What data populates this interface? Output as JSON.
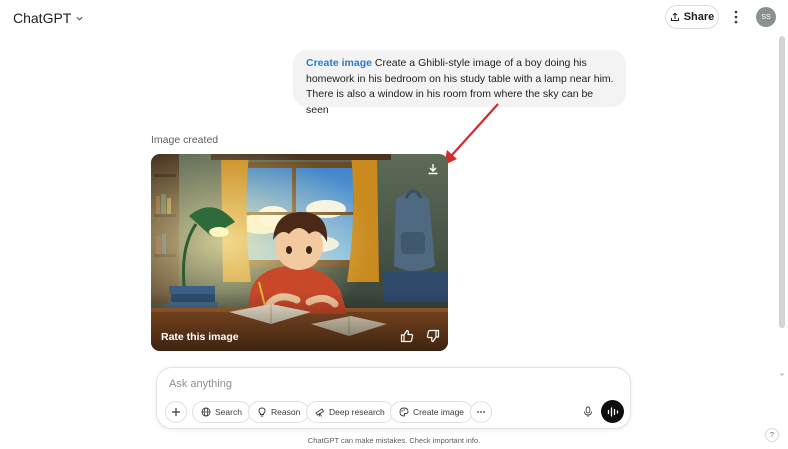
{
  "header": {
    "app_title": "ChatGPT",
    "share_label": "Share",
    "avatar_initials": "SS"
  },
  "conversation": {
    "user_message": {
      "tag": "Create image",
      "text": "Create a Ghibli-style image of a boy doing his homework in his bedroom on his study table with a lamp near him. There is also a window in his room from where the sky can be seen"
    },
    "assistant": {
      "status": "Image created",
      "rate_label": "Rate this image"
    }
  },
  "composer": {
    "placeholder": "Ask anything",
    "tools": {
      "search": "Search",
      "reason": "Reason",
      "deep_research": "Deep research",
      "create_image": "Create image"
    }
  },
  "footer": {
    "disclaimer": "ChatGPT can make mistakes. Check important info.",
    "help": "?"
  },
  "colors": {
    "accent_tag": "#2a7bd0",
    "annotation_arrow": "#d42a2a",
    "voice_button": "#0d0d0d"
  },
  "icons": [
    "chevron-down-icon",
    "share-icon",
    "more-vertical-icon",
    "download-icon",
    "thumbs-up-icon",
    "thumbs-down-icon",
    "plus-icon",
    "globe-icon",
    "lightbulb-icon",
    "telescope-icon",
    "palette-icon",
    "ellipsis-icon",
    "microphone-icon",
    "voice-wave-icon"
  ]
}
